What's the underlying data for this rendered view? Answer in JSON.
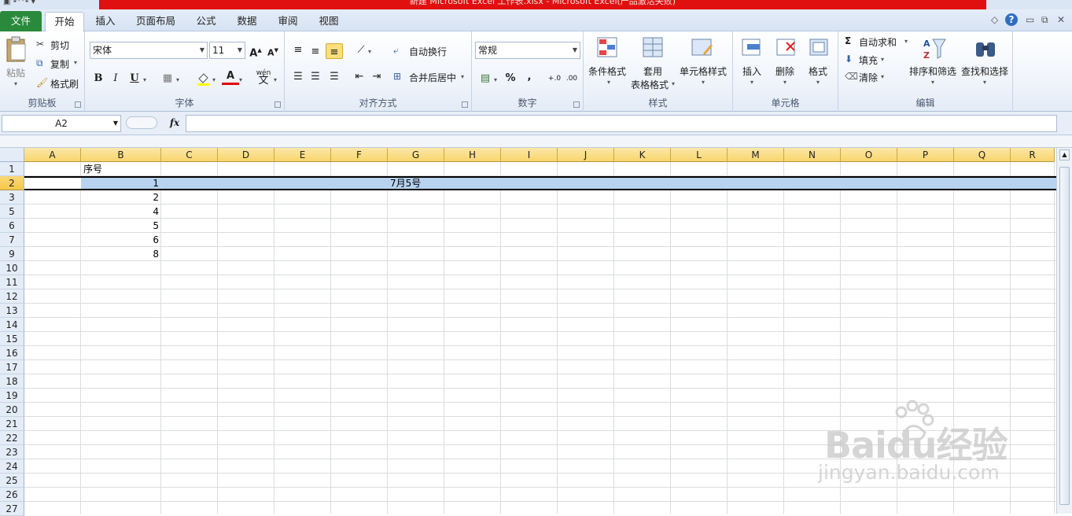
{
  "window": {
    "title": "新建 Microsoft Excel 工作表.xlsx - Microsoft Excel(产品激活失败)",
    "help_icon": "?",
    "minimize": "▭",
    "restore": "⧉",
    "close": "✕"
  },
  "tabs": [
    "文件",
    "开始",
    "插入",
    "页面布局",
    "公式",
    "数据",
    "审阅",
    "视图"
  ],
  "ribbon": {
    "clipboard": {
      "paste": "粘贴",
      "cut": "剪切",
      "copy": "复制",
      "format_painter": "格式刷",
      "label": "剪贴板"
    },
    "font": {
      "name": "宋体",
      "size": "11",
      "bold": "B",
      "italic": "I",
      "underline": "U",
      "wen": "wén",
      "wen2": "文",
      "label": "字体"
    },
    "alignment": {
      "wrap": "自动换行",
      "merge": "合并后居中",
      "label": "对齐方式"
    },
    "number": {
      "format": "常规",
      "percent": "%",
      "comma": ",",
      "label": "数字"
    },
    "styles": {
      "conditional": "条件格式",
      "table_line1": "套用",
      "table_line2": "表格格式",
      "cell_styles": "单元格样式",
      "label": "样式"
    },
    "cells": {
      "insert": "插入",
      "delete": "删除",
      "format": "格式",
      "label": "单元格"
    },
    "editing": {
      "autosum_symbol": "Σ",
      "autosum": "自动求和",
      "fill": "填充",
      "clear": "清除",
      "sort": "排序和筛选",
      "find": "查找和选择",
      "label": "编辑"
    }
  },
  "formula_bar": {
    "name_box": "A2",
    "fx": "fx",
    "value": ""
  },
  "columns": [
    "A",
    "B",
    "C",
    "D",
    "E",
    "F",
    "G",
    "H",
    "I",
    "J",
    "K",
    "L",
    "M",
    "N",
    "O",
    "P",
    "Q",
    "R"
  ],
  "rows": [
    "1",
    "2",
    "3",
    "5",
    "6",
    "7",
    "9",
    "10",
    "11",
    "12",
    "13",
    "14",
    "15",
    "16",
    "17",
    "18",
    "19",
    "20",
    "21",
    "22",
    "23",
    "24",
    "25",
    "26",
    "27"
  ],
  "cells": {
    "B1": "序号",
    "B2": "1",
    "B3": "2",
    "B5": "4",
    "B6": "5",
    "B7": "6",
    "B9": "8",
    "G2": "7月5号"
  },
  "watermark": {
    "logo": "Baidu经验",
    "url": "jingyan.baidu.com"
  },
  "colors": {
    "title_bar": "#e11010",
    "file_tab": "#2a8a3c",
    "selected_row": "#b7d3f0",
    "header": "#f9d56c"
  }
}
